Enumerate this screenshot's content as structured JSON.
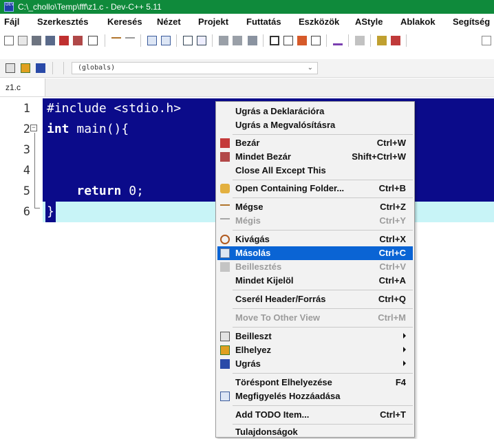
{
  "window": {
    "title": "C:\\_chollo\\Temp\\fff\\z1.c - Dev-C++ 5.11",
    "app_icon_text": "DEV"
  },
  "menubar": [
    "Fájl",
    "Szerkesztés",
    "Keresés",
    "Nézet",
    "Projekt",
    "Futtatás",
    "Eszközök",
    "AStyle",
    "Ablakok",
    "Segítség"
  ],
  "toolbar2": {
    "scope_value": "(globals)"
  },
  "tabs": [
    {
      "label": "z1.c"
    }
  ],
  "editor": {
    "line_numbers": [
      "1",
      "2",
      "3",
      "4",
      "5",
      "6"
    ],
    "lines": [
      {
        "text": "#include <stdio.h>"
      },
      {
        "kw": "int",
        "rest": " main(){"
      },
      {
        "text": ""
      },
      {
        "text": ""
      },
      {
        "kw": "return",
        "rest": " 0;",
        "indent": "    "
      },
      {
        "text": "}"
      }
    ]
  },
  "context_menu": {
    "items": [
      {
        "label": "Ugrás a Deklarációra",
        "shortcut": ""
      },
      {
        "label": "Ugrás a Megvalósításra",
        "shortcut": ""
      },
      {
        "label": "Bezár",
        "shortcut": "Ctrl+W",
        "icon": "close-file-icon"
      },
      {
        "label": "Mindet Bezár",
        "shortcut": "Shift+Ctrl+W",
        "icon": "close-all-icon"
      },
      {
        "label": "Close All Except This",
        "shortcut": ""
      },
      {
        "label": "Open Containing Folder...",
        "shortcut": "Ctrl+B",
        "icon": "folder-icon"
      },
      {
        "label": "Mégse",
        "shortcut": "Ctrl+Z",
        "icon": "undo-icon"
      },
      {
        "label": "Mégis",
        "shortcut": "Ctrl+Y",
        "icon": "redo-icon",
        "disabled": true
      },
      {
        "label": "Kivágás",
        "shortcut": "Ctrl+X",
        "icon": "scissors-icon"
      },
      {
        "label": "Másolás",
        "shortcut": "Ctrl+C",
        "icon": "copy-icon",
        "highlighted": true
      },
      {
        "label": "Beillesztés",
        "shortcut": "Ctrl+V",
        "icon": "paste-icon",
        "disabled": true
      },
      {
        "label": "Mindet Kijelöl",
        "shortcut": "Ctrl+A"
      },
      {
        "label": "Cserél Header/Forrás",
        "shortcut": "Ctrl+Q"
      },
      {
        "label": "Move To Other View",
        "shortcut": "Ctrl+M",
        "disabled": true
      },
      {
        "label": "Beilleszt",
        "shortcut": "",
        "icon": "insert-icon",
        "submenu": true
      },
      {
        "label": "Elhelyez",
        "shortcut": "",
        "icon": "bookmark-toggle-icon",
        "submenu": true
      },
      {
        "label": "Ugrás",
        "shortcut": "",
        "icon": "goto-bookmark-icon",
        "submenu": true
      },
      {
        "label": "Töréspont Elhelyezése",
        "shortcut": "F4"
      },
      {
        "label": "Megfigyelés Hozzáadása",
        "shortcut": "",
        "icon": "watch-icon"
      },
      {
        "label": "Add TODO Item...",
        "shortcut": "Ctrl+T"
      },
      {
        "label": "Tulajdonságok",
        "shortcut": ""
      }
    ]
  },
  "colors": {
    "titlebar": "#0f8a3b",
    "selection": "#0b0b8a",
    "current_line": "#c8f4f7",
    "menu_highlight": "#0a64d4"
  }
}
